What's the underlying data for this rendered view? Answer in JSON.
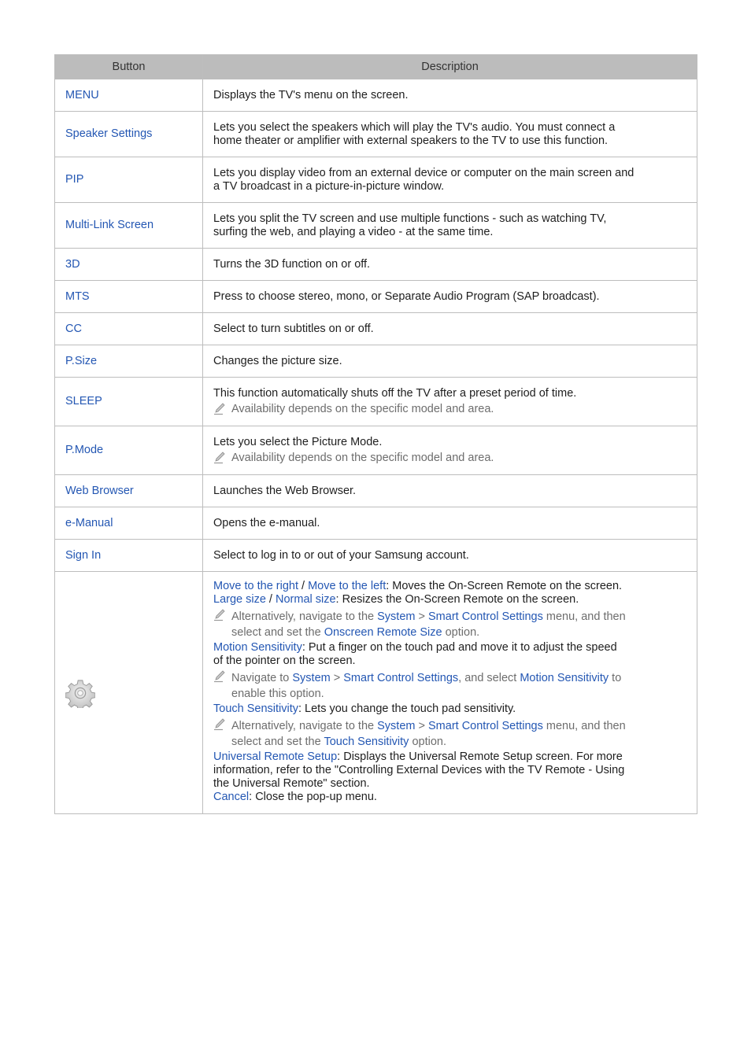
{
  "table": {
    "headers": [
      "Button",
      "Description"
    ],
    "rows": [
      {
        "button": "MENU",
        "description": "Displays the TV's menu on the screen."
      },
      {
        "button": "Speaker Settings",
        "description_lines": [
          "Lets you select the speakers which will play the TV's audio. You must connect a",
          "home theater or amplifier with external speakers to the TV to use this function."
        ]
      },
      {
        "button": "PIP",
        "description_lines": [
          "Lets you display video from an external device or computer on the main screen and",
          "a TV broadcast in a picture-in-picture window."
        ]
      },
      {
        "button": "Multi-Link Screen",
        "description_lines": [
          "Lets you split the TV screen and use multiple functions - such as watching TV,",
          "surfing the web, and playing a video - at the same time."
        ]
      },
      {
        "button": "3D",
        "description": "Turns the 3D function on or off."
      },
      {
        "button": "MTS",
        "description": "Press to choose stereo, mono, or Separate Audio Program (SAP broadcast)."
      },
      {
        "button": "CC",
        "description": "Select to turn subtitles on or off."
      },
      {
        "button": "P.Size",
        "description": "Changes the picture size."
      },
      {
        "button": "SLEEP",
        "description": "This function automatically shuts off the TV after a preset period of time.",
        "note": "Availability depends on the specific model and area."
      },
      {
        "button": "P.Mode",
        "description": "Lets you select the Picture Mode.",
        "note": "Availability depends on the specific model and area."
      },
      {
        "button": "Web Browser",
        "description": "Launches the Web Browser."
      },
      {
        "button": "e-Manual",
        "description": "Opens the e-manual."
      },
      {
        "button": "Sign In",
        "description": "Select to log in to or out of your Samsung account."
      }
    ],
    "settings_row": {
      "icon": "gear-icon",
      "move_right": "Move to the right",
      "slash": " / ",
      "move_left": "Move to the left",
      "move_desc": ": Moves the On-Screen Remote on the screen.",
      "large_size": "Large size",
      "normal_size": "Normal size",
      "size_desc": ": Resizes the On-Screen Remote on the screen.",
      "note1_a": "Alternatively, navigate to the ",
      "system": "System",
      "chevron": " > ",
      "smart_control_settings": "Smart Control Settings",
      "note1_b": " menu, and then",
      "note1_c": "select and set the ",
      "onscreen_remote_size": "Onscreen Remote Size",
      "option": " option.",
      "motion_sensitivity": "Motion Sensitivity",
      "motion_desc_1": ": Put a finger on the touch pad and move it to adjust the speed",
      "motion_desc_2": "of the pointer on the screen.",
      "note2_a": "Navigate to ",
      "note2_b": ", and select ",
      "note2_c": " to",
      "note2_d": "enable this option.",
      "touch_sensitivity": "Touch Sensitivity",
      "touch_desc": ": Lets you change the touch pad sensitivity.",
      "universal_remote_setup": "Universal Remote Setup",
      "universal_desc_1": ": Displays the Universal Remote Setup screen. For more",
      "universal_desc_2": "information, refer to the \"Controlling External Devices with the TV Remote - Using",
      "universal_desc_3": "the Universal Remote\" section.",
      "cancel": "Cancel",
      "cancel_desc": ": Close the pop-up menu."
    }
  },
  "colors": {
    "link_blue": "#2457b3",
    "header_bg": "#bcbcbc",
    "border": "#bdbdbd",
    "note_gray": "#6d6d6d"
  }
}
